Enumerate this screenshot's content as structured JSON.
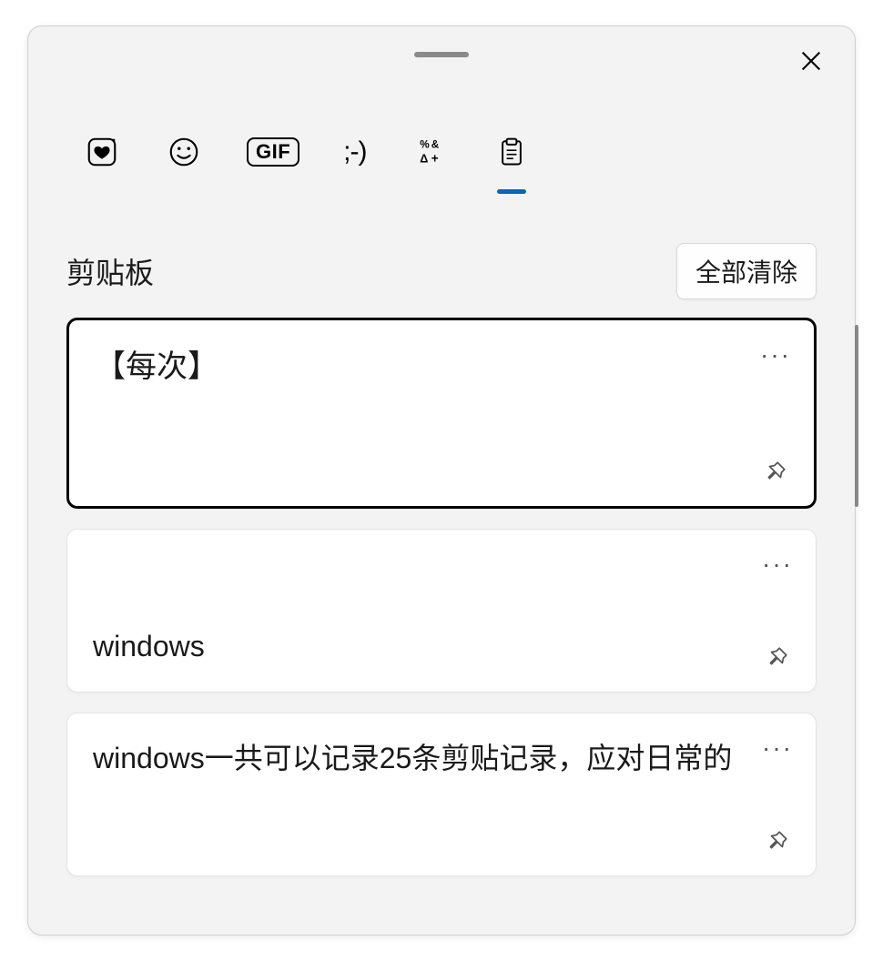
{
  "header": {
    "tabs": [
      {
        "name": "stickers",
        "active": false
      },
      {
        "name": "emoji",
        "active": false
      },
      {
        "name": "gif",
        "active": false,
        "label": "GIF"
      },
      {
        "name": "kaomoji",
        "active": false,
        "label": ";-)"
      },
      {
        "name": "symbols",
        "active": false
      },
      {
        "name": "clipboard",
        "active": true
      }
    ]
  },
  "section": {
    "title": "剪贴板",
    "clear_all": "全部清除"
  },
  "items": [
    {
      "text": "【每次】",
      "selected": true
    },
    {
      "text": "windows",
      "selected": false
    },
    {
      "text": "windows一共可以记录25条剪贴记录，应对日常的",
      "selected": false
    }
  ]
}
